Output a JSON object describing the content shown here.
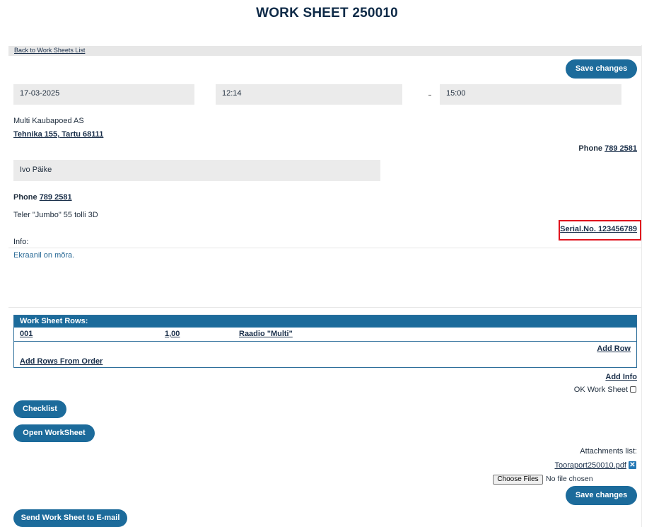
{
  "page": {
    "title": "WORK SHEET 250010",
    "back_link": "Back to Work Sheets List"
  },
  "buttons": {
    "save_top": "Save changes",
    "checklist": "Checklist",
    "open_worksheet": "Open WorkSheet",
    "save_bottom": "Save changes",
    "send_email": "Send Work Sheet to E-mail"
  },
  "schedule": {
    "date": "17-03-2025",
    "time_start": "12:14",
    "time_end": "15:00"
  },
  "client": {
    "company": "Multi Kaubapoed AS",
    "address": "Tehnika 155, Tartu 68111",
    "phone_label": "Phone",
    "phone": "789 2581"
  },
  "contact": {
    "name": "Ivo Päike",
    "phone_label": "Phone",
    "phone": "789 2581"
  },
  "device": {
    "name": "Teler \"Jumbo\" 55 tolli 3D",
    "serial": "Serial.No. 123456789"
  },
  "info": {
    "label": "Info:",
    "text": "Ekraanil on mõra."
  },
  "work_rows": {
    "header": "Work Sheet Rows:",
    "rows": [
      {
        "code": "001",
        "qty": "1,00",
        "name": "Raadio \"Multi\""
      }
    ],
    "add_row": "Add Row",
    "add_from_order": "Add Rows From Order"
  },
  "options": {
    "add_info": "Add Info",
    "ok_label": "OK Work Sheet"
  },
  "attachments": {
    "label": "Attachments list:",
    "files": [
      "Tooraport250010.pdf"
    ],
    "choose_label": "Choose Files",
    "no_file": "No file chosen"
  },
  "colors": {
    "button_bg": "#1c6b9b",
    "highlight": "#e0141e",
    "field_bg": "#ebebeb"
  }
}
